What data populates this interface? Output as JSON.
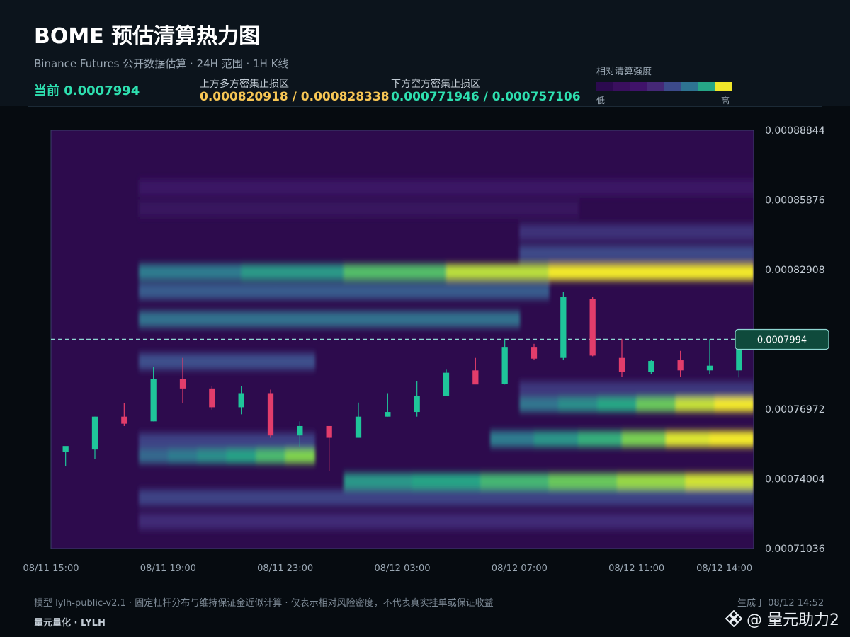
{
  "header": {
    "title": "BOME 预估清算热力图",
    "subtitle": "Binance Futures 公开数据估算 · 24H 范围 · 1H K线",
    "current_label": "当前 0.0007994",
    "upper_label": "上方多方密集止损区",
    "upper_values": "0.000820918 / 0.000828338",
    "lower_label": "下方空方密集止损区",
    "lower_values": "0.000771946 / 0.000757106"
  },
  "legend": {
    "title": "相对清算强度",
    "low": "低",
    "high": "高",
    "colors": [
      "#2c0a4f",
      "#3a0f5e",
      "#40136a",
      "#452876",
      "#3c4a8a",
      "#2e7391",
      "#26a686",
      "#f0e62a"
    ]
  },
  "footer": {
    "note": "模型 lylh-public-v2.1 · 固定杠杆分布与维持保证金近似计算 · 仅表示相对风险密度，不代表真实挂单或保证收益",
    "brand": "量元量化 · LYLH",
    "generated": "生成于 08/12 14:52",
    "watermark": "@ 量元助力2"
  },
  "chart_data": {
    "type": "heatmap",
    "title": "BOME 预估清算热力图",
    "y_ticks": [
      "0.00088844",
      "0.00085876",
      "0.00082908",
      "0.00079940",
      "0.00076972",
      "0.00074004",
      "0.00071036"
    ],
    "y_tick_labels": [
      "0.00088844",
      "0.00085876",
      "0.00082908",
      "0.00076972",
      "0.00074004",
      "0.00071036"
    ],
    "ylim": [
      0.00071036,
      0.00088844
    ],
    "x_ticks": [
      "08/11 15:00",
      "08/11 19:00",
      "08/11 23:00",
      "08/12 03:00",
      "08/12 07:00",
      "08/12 11:00",
      "08/12 14:00"
    ],
    "x_tick_hours": [
      0,
      4,
      8,
      12,
      16,
      20,
      23
    ],
    "current_price": 0.0007994,
    "current_price_label": "0.0007994",
    "colors": {
      "up": "#1fc59a",
      "down": "#e23d6b",
      "current_line": "#8fd6d2"
    },
    "bands": [
      {
        "price": 0.000864,
        "from": 3,
        "to": 24,
        "intensity": 0.18
      },
      {
        "price": 0.000855,
        "from": 3,
        "to": 18,
        "intensity": 0.14
      },
      {
        "price": 0.000845,
        "from": 16,
        "to": 24,
        "intensity": 0.32
      },
      {
        "price": 0.000836,
        "from": 16,
        "to": 24,
        "intensity": 0.42
      },
      {
        "price": 0.000828,
        "from": 3,
        "to": 24,
        "intensity": 0.62,
        "grow": 0.55
      },
      {
        "price": 0.00082,
        "from": 3,
        "to": 17,
        "intensity": 0.5
      },
      {
        "price": 0.000808,
        "from": 3,
        "to": 16,
        "intensity": 0.58
      },
      {
        "price": 0.00079,
        "from": 3,
        "to": 9,
        "intensity": 0.45
      },
      {
        "price": 0.000772,
        "from": 16,
        "to": 24,
        "intensity": 0.6,
        "grow": 0.45
      },
      {
        "price": 0.000778,
        "from": 16,
        "to": 24,
        "intensity": 0.35
      },
      {
        "price": 0.000757,
        "from": 15,
        "to": 24,
        "intensity": 0.62,
        "grow": 0.45
      },
      {
        "price": 0.00075,
        "from": 3,
        "to": 9,
        "intensity": 0.55,
        "grow": 0.35
      },
      {
        "price": 0.000756,
        "from": 3,
        "to": 9,
        "intensity": 0.4
      },
      {
        "price": 0.000739,
        "from": 10,
        "to": 24,
        "intensity": 0.72,
        "grow": 0.25
      },
      {
        "price": 0.000732,
        "from": 3,
        "to": 24,
        "intensity": 0.4
      },
      {
        "price": 0.000722,
        "from": 3,
        "to": 24,
        "intensity": 0.3
      }
    ],
    "candles": [
      {
        "t": 0,
        "o": 0.0007515,
        "h": 0.0007535,
        "l": 0.0007455,
        "c": 0.000754
      },
      {
        "t": 1,
        "o": 0.0007525,
        "h": 0.0007665,
        "l": 0.0007485,
        "c": 0.0007665
      },
      {
        "t": 2,
        "o": 0.0007665,
        "h": 0.0007722,
        "l": 0.0007625,
        "c": 0.0007635
      },
      {
        "t": 3,
        "o": 0.0007645,
        "h": 0.0007875,
        "l": 0.0007645,
        "c": 0.0007825
      },
      {
        "t": 4,
        "o": 0.0007825,
        "h": 0.0007915,
        "l": 0.0007722,
        "c": 0.0007785
      },
      {
        "t": 5,
        "o": 0.0007785,
        "h": 0.0007795,
        "l": 0.0007695,
        "c": 0.0007705
      },
      {
        "t": 6,
        "o": 0.0007705,
        "h": 0.0007795,
        "l": 0.0007675,
        "c": 0.0007765
      },
      {
        "t": 7,
        "o": 0.0007765,
        "h": 0.000778,
        "l": 0.0007575,
        "c": 0.0007585
      },
      {
        "t": 8,
        "o": 0.0007585,
        "h": 0.0007645,
        "l": 0.0007535,
        "c": 0.0007625
      },
      {
        "t": 9,
        "o": 0.0007625,
        "h": 0.0007625,
        "l": 0.0007435,
        "c": 0.0007575
      },
      {
        "t": 10,
        "o": 0.0007575,
        "h": 0.0007725,
        "l": 0.0007575,
        "c": 0.0007665
      },
      {
        "t": 11,
        "o": 0.0007665,
        "h": 0.0007765,
        "l": 0.0007665,
        "c": 0.0007685
      },
      {
        "t": 12,
        "o": 0.0007685,
        "h": 0.0007815,
        "l": 0.0007665,
        "c": 0.0007752
      },
      {
        "t": 13,
        "o": 0.0007752,
        "h": 0.0007865,
        "l": 0.0007752,
        "c": 0.0007852
      },
      {
        "t": 14,
        "o": 0.0007862,
        "h": 0.0007915,
        "l": 0.0007822,
        "c": 0.0007802
      },
      {
        "t": 15,
        "o": 0.0007805,
        "h": 0.0007995,
        "l": 0.0007802,
        "c": 0.0007962
      },
      {
        "t": 16,
        "o": 0.0007962,
        "h": 0.0007975,
        "l": 0.0007905,
        "c": 0.0007912
      },
      {
        "t": 17,
        "o": 0.0007915,
        "h": 0.0008195,
        "l": 0.0007905,
        "c": 0.0008175
      },
      {
        "t": 18,
        "o": 0.0008165,
        "h": 0.0008175,
        "l": 0.0007922,
        "c": 0.0007925
      },
      {
        "t": 19,
        "o": 0.0007915,
        "h": 0.0007995,
        "l": 0.0007835,
        "c": 0.0007855
      },
      {
        "t": 20,
        "o": 0.0007855,
        "h": 0.0007905,
        "l": 0.0007845,
        "c": 0.0007902
      },
      {
        "t": 21,
        "o": 0.0007905,
        "h": 0.0007945,
        "l": 0.0007835,
        "c": 0.0007862
      },
      {
        "t": 22,
        "o": 0.0007862,
        "h": 0.0007995,
        "l": 0.0007845,
        "c": 0.0007882
      },
      {
        "t": 23,
        "o": 0.0007862,
        "h": 0.0007994,
        "l": 0.0007832,
        "c": 0.0007994
      }
    ]
  }
}
